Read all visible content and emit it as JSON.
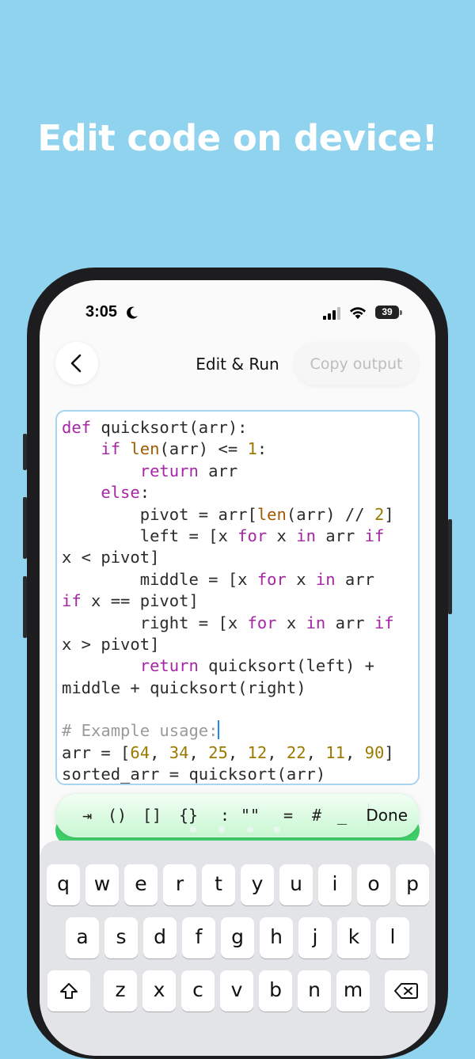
{
  "headline": "Edit code on device!",
  "status_bar": {
    "time": "3:05",
    "battery": "39"
  },
  "nav": {
    "title": "Edit & Run",
    "copy_button": "Copy output"
  },
  "editor": {
    "lines": [
      [
        [
          "kw",
          "def"
        ],
        [
          "t",
          " quicksort(arr):"
        ]
      ],
      [
        [
          "t",
          "    "
        ],
        [
          "kw",
          "if"
        ],
        [
          "t",
          " "
        ],
        [
          "fn",
          "len"
        ],
        [
          "t",
          "(arr) <= "
        ],
        [
          "num",
          "1"
        ],
        [
          "t",
          ":"
        ]
      ],
      [
        [
          "t",
          "        "
        ],
        [
          "kw",
          "return"
        ],
        [
          "t",
          " arr"
        ]
      ],
      [
        [
          "t",
          "    "
        ],
        [
          "kw",
          "else"
        ],
        [
          "t",
          ":"
        ]
      ],
      [
        [
          "t",
          "        pivot = arr["
        ],
        [
          "fn",
          "len"
        ],
        [
          "t",
          "(arr) // "
        ],
        [
          "num",
          "2"
        ],
        [
          "t",
          "]"
        ]
      ],
      [
        [
          "t",
          "        left = [x "
        ],
        [
          "kw",
          "for"
        ],
        [
          "t",
          " x "
        ],
        [
          "kw",
          "in"
        ],
        [
          "t",
          " arr "
        ],
        [
          "kw",
          "if"
        ]
      ],
      [
        [
          "t",
          "x < pivot]"
        ]
      ],
      [
        [
          "t",
          "        middle = [x "
        ],
        [
          "kw",
          "for"
        ],
        [
          "t",
          " x "
        ],
        [
          "kw",
          "in"
        ],
        [
          "t",
          " arr"
        ]
      ],
      [
        [
          "kw",
          "if"
        ],
        [
          "t",
          " x == pivot]"
        ]
      ],
      [
        [
          "t",
          "        right = [x "
        ],
        [
          "kw",
          "for"
        ],
        [
          "t",
          " x "
        ],
        [
          "kw",
          "in"
        ],
        [
          "t",
          " arr "
        ],
        [
          "kw",
          "if"
        ]
      ],
      [
        [
          "t",
          "x > pivot]"
        ]
      ],
      [
        [
          "t",
          "        "
        ],
        [
          "kw",
          "return"
        ],
        [
          "t",
          " quicksort(left) +"
        ]
      ],
      [
        [
          "t",
          "middle + quicksort(right)"
        ]
      ],
      [
        [
          "t",
          ""
        ]
      ],
      [
        [
          "cm",
          "# Example usage:"
        ],
        [
          "cursor",
          ""
        ]
      ],
      [
        [
          "t",
          "arr = ["
        ],
        [
          "num",
          "64"
        ],
        [
          "t",
          ", "
        ],
        [
          "num",
          "34"
        ],
        [
          "t",
          ", "
        ],
        [
          "num",
          "25"
        ],
        [
          "t",
          ", "
        ],
        [
          "num",
          "12"
        ],
        [
          "t",
          ", "
        ],
        [
          "num",
          "22"
        ],
        [
          "t",
          ", "
        ],
        [
          "num",
          "11"
        ],
        [
          "t",
          ", "
        ],
        [
          "num",
          "90"
        ],
        [
          "t",
          "]"
        ]
      ],
      [
        [
          "t",
          "sorted_arr = quicksort(arr)"
        ]
      ]
    ]
  },
  "accessory_bar": {
    "keys": [
      "⇥",
      "()",
      "[]",
      "{}",
      ":",
      "\"\"",
      "=",
      "#",
      "_"
    ],
    "done": "Done"
  },
  "keyboard": {
    "row1": [
      "q",
      "w",
      "e",
      "r",
      "t",
      "y",
      "u",
      "i",
      "o",
      "p"
    ],
    "row2": [
      "a",
      "s",
      "d",
      "f",
      "g",
      "h",
      "j",
      "k",
      "l"
    ],
    "row3": [
      "z",
      "x",
      "c",
      "v",
      "b",
      "n",
      "m"
    ]
  }
}
